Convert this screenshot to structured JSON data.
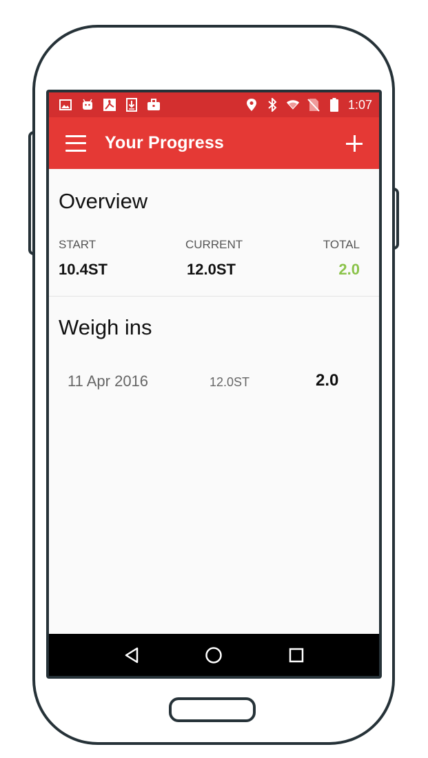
{
  "status_bar": {
    "time": "1:07",
    "left_icons": [
      "image-icon",
      "android-icon",
      "pdf-icon",
      "download-icon",
      "briefcase-icon"
    ],
    "right_icons": [
      "location-icon",
      "bluetooth-icon",
      "wifi-icon",
      "no-sim-icon",
      "battery-icon"
    ]
  },
  "app_bar": {
    "title": "Your Progress",
    "menu_icon": "hamburger-menu-icon",
    "action_icon": "plus-icon"
  },
  "overview": {
    "title": "Overview",
    "start_label": "START",
    "start_value": "10.4ST",
    "current_label": "CURRENT",
    "current_value": "12.0ST",
    "total_label": "TOTAL",
    "total_value": "2.0"
  },
  "weigh_ins": {
    "title": "Weigh ins",
    "entries": [
      {
        "date": "11 Apr 2016",
        "weight": "12.0ST",
        "change": "2.0"
      }
    ]
  },
  "nav_bar": {
    "icons": [
      "back-icon",
      "home-icon",
      "recents-icon"
    ]
  },
  "colors": {
    "status_bar": "#d32f2f",
    "app_bar": "#e53935",
    "positive_total": "#8bc34a",
    "frame": "#263238"
  }
}
